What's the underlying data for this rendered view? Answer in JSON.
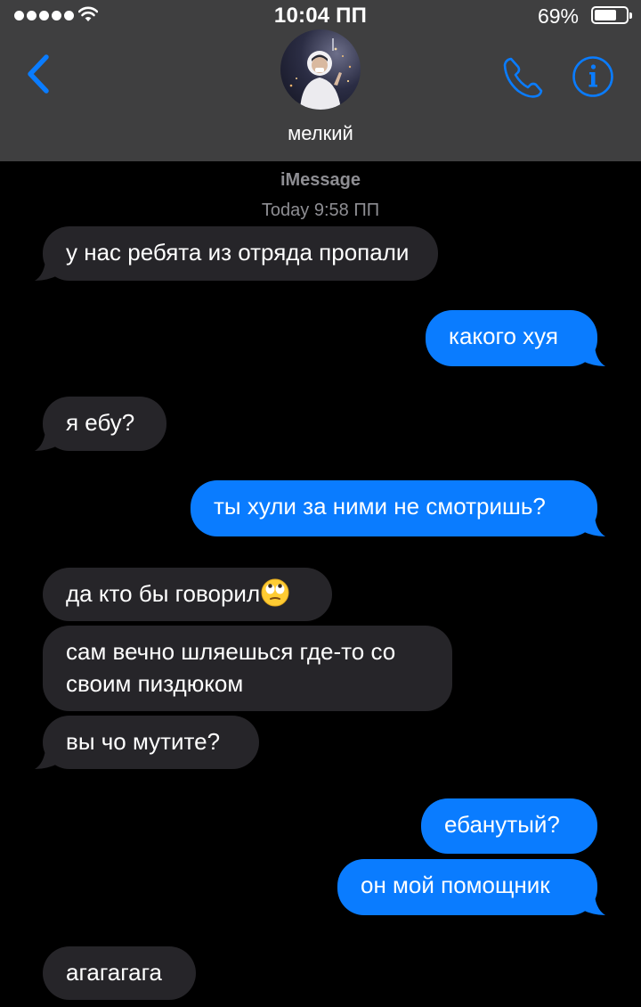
{
  "status_bar": {
    "time": "10:04 ПП",
    "battery": "69%",
    "icons": [
      "signal-dots",
      "wifi-icon",
      "battery-icon"
    ]
  },
  "header": {
    "contact_name": "мелкий",
    "back_icon": "chevron-left-icon",
    "call_icon": "phone-icon",
    "info_icon": "info-icon"
  },
  "thread": {
    "service": "iMessage",
    "timestamp": "Today 9:58 ПП",
    "messages": [
      {
        "direction": "in",
        "text": "у нас ребята из отряда пропали"
      },
      {
        "direction": "out",
        "text": "какого хуя"
      },
      {
        "direction": "in",
        "text": "я ебу?"
      },
      {
        "direction": "out",
        "text": "ты хули за ними не смотришь?"
      },
      {
        "direction": "in",
        "text": "да кто бы говорил",
        "emoji": "face-with-rolling-eyes-icon"
      },
      {
        "direction": "in",
        "text": "сам вечно шляешься где-то со своим пиздюком"
      },
      {
        "direction": "in",
        "text": "вы чо мутите?"
      },
      {
        "direction": "out",
        "text": "ебанутый?"
      },
      {
        "direction": "out",
        "text": "он мой помощник"
      },
      {
        "direction": "in",
        "text": "агагагага"
      }
    ]
  },
  "colors": {
    "header_bg": "#3f3f40",
    "incoming_bubble": "#262529",
    "outgoing_bubble": "#0a7cff",
    "accent": "#0a7cff",
    "meta_text": "#8e8e93"
  }
}
